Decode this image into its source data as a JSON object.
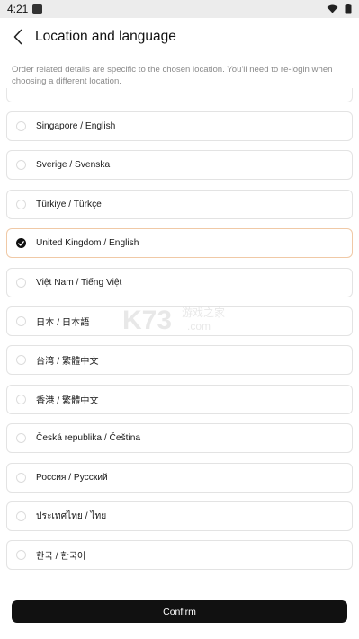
{
  "status_bar": {
    "time": "4:21",
    "icons": [
      "app-notification-icon",
      "wifi-icon",
      "battery-icon"
    ]
  },
  "header": {
    "title": "Location and language",
    "back_icon": "chevron-left-icon"
  },
  "description": "Order related details are specific to the chosen location. You'll need to re-login when choosing a different location.",
  "options": [
    {
      "label": "Singapore / English",
      "selected": false
    },
    {
      "label": "Sverige / Svenska",
      "selected": false
    },
    {
      "label": "Türkiye / Türkçe",
      "selected": false
    },
    {
      "label": "United Kingdom / English",
      "selected": true
    },
    {
      "label": "Việt Nam / Tiếng Việt",
      "selected": false
    },
    {
      "label": "日本 / 日本語",
      "selected": false
    },
    {
      "label": "台湾 / 繁體中文",
      "selected": false
    },
    {
      "label": "香港 / 繁體中文",
      "selected": false
    },
    {
      "label": "Česká republika / Čeština",
      "selected": false
    },
    {
      "label": "Россия / Русский",
      "selected": false
    },
    {
      "label": "ประเทศไทย / ไทย",
      "selected": false
    },
    {
      "label": "한국 / 한국어",
      "selected": false
    }
  ],
  "watermark": {
    "main": "K73",
    "cn": "游戏之家",
    "domain": ".com"
  },
  "confirm_label": "Confirm",
  "colors": {
    "accent_border": "#f0c9a6",
    "button_bg": "#111111",
    "status_bar_bg": "#ececec"
  }
}
